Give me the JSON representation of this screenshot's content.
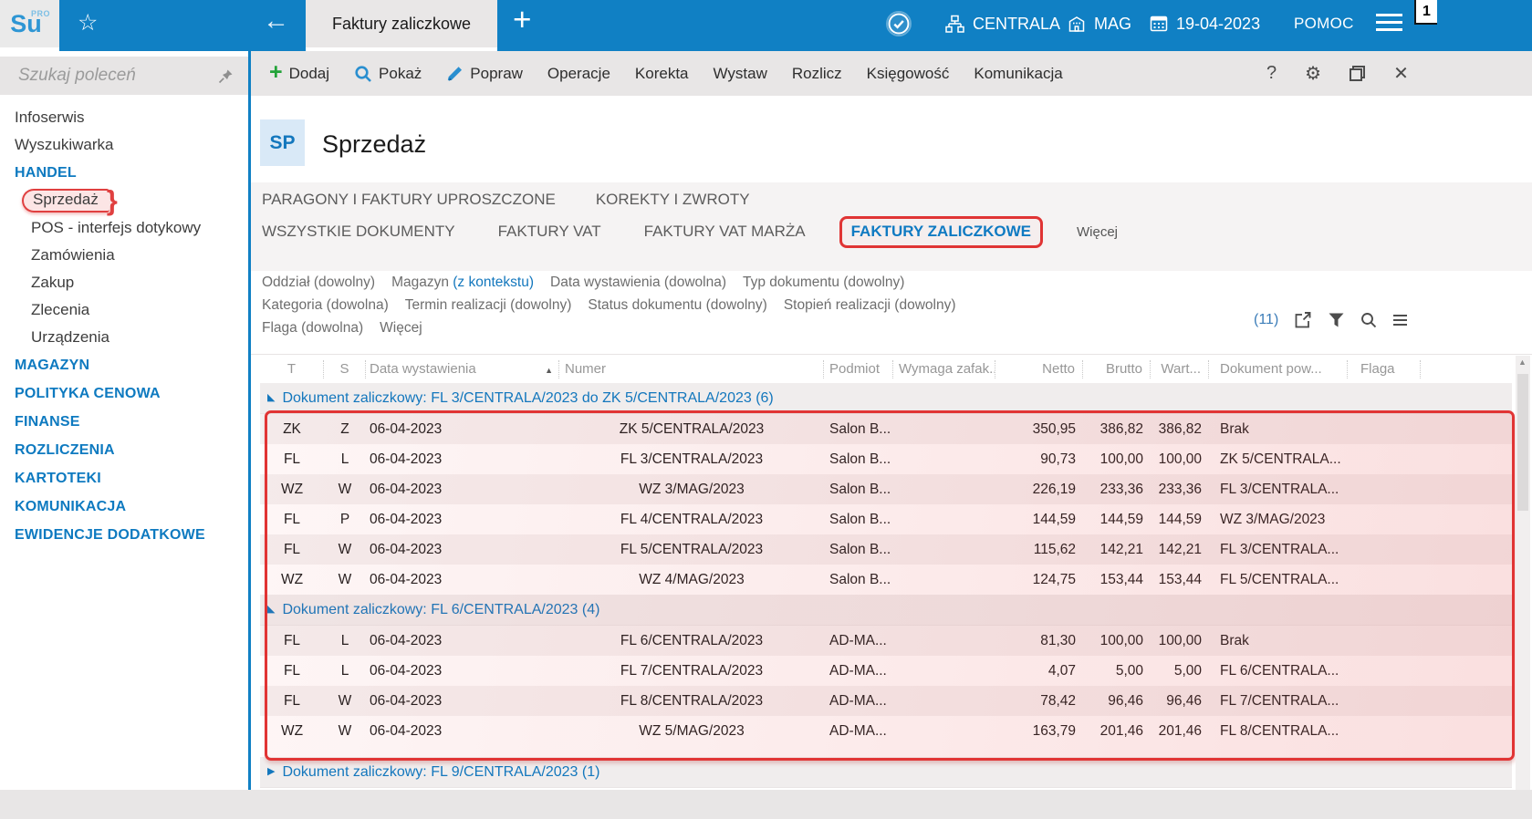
{
  "topbar": {
    "logo_text": "Su",
    "logo_sup": "PRO",
    "active_tab": "Faktury zaliczkowe",
    "branch": "CENTRALA",
    "warehouse": "MAG",
    "date": "19-04-2023",
    "help_label": "POMOC",
    "notification_count": "1"
  },
  "sidebar": {
    "search_placeholder": "Szukaj poleceń",
    "items": [
      {
        "label": "Infoserwis",
        "type": "item"
      },
      {
        "label": "Wyszukiwarka",
        "type": "item"
      },
      {
        "label": "HANDEL",
        "type": "section"
      },
      {
        "label": "Sprzedaż",
        "type": "subitem",
        "annotated": true
      },
      {
        "label": "POS - interfejs dotykowy",
        "type": "subitem"
      },
      {
        "label": "Zamówienia",
        "type": "subitem"
      },
      {
        "label": "Zakup",
        "type": "subitem"
      },
      {
        "label": "Zlecenia",
        "type": "subitem"
      },
      {
        "label": "Urządzenia",
        "type": "subitem"
      },
      {
        "label": "MAGAZYN",
        "type": "section"
      },
      {
        "label": "POLITYKA CENOWA",
        "type": "section"
      },
      {
        "label": "FINANSE",
        "type": "section"
      },
      {
        "label": "ROZLICZENIA",
        "type": "section"
      },
      {
        "label": "KARTOTEKI",
        "type": "section"
      },
      {
        "label": "KOMUNIKACJA",
        "type": "section"
      },
      {
        "label": "EWIDENCJE DODATKOWE",
        "type": "section"
      }
    ]
  },
  "toolbar": {
    "items": [
      {
        "label": "Dodaj",
        "icon": "plus-icon"
      },
      {
        "label": "Pokaż",
        "icon": "search-icon"
      },
      {
        "label": "Popraw",
        "icon": "brush-icon"
      },
      {
        "label": "Operacje"
      },
      {
        "label": "Korekta"
      },
      {
        "label": "Wystaw"
      },
      {
        "label": "Rozlicz"
      },
      {
        "label": "Księgowość"
      },
      {
        "label": "Komunikacja"
      }
    ]
  },
  "page": {
    "badge": "SP",
    "title": "Sprzedaż"
  },
  "tabs_row1": [
    {
      "label": "PARAGONY I FAKTURY UPROSZCZONE"
    },
    {
      "label": "KOREKTY I ZWROTY"
    }
  ],
  "tabs_row2": [
    {
      "label": "WSZYSTKIE DOKUMENTY"
    },
    {
      "label": "FAKTURY VAT"
    },
    {
      "label": "FAKTURY VAT MARŻA"
    },
    {
      "label": "FAKTURY ZALICZKOWE",
      "active": true,
      "annotated": true
    },
    {
      "label": "Więcej",
      "more": true
    }
  ],
  "filters": {
    "rows": [
      [
        {
          "name": "Oddział",
          "value": "(dowolny)"
        },
        {
          "name": "Magazyn",
          "value": "(z kontekstu)",
          "accent": true
        },
        {
          "name": "Data wystawienia",
          "value": "(dowolna)"
        },
        {
          "name": "Typ dokumentu",
          "value": "(dowolny)"
        }
      ],
      [
        {
          "name": "Kategoria",
          "value": "(dowolna)"
        },
        {
          "name": "Termin realizacji",
          "value": "(dowolny)"
        },
        {
          "name": "Status dokumentu",
          "value": "(dowolny)"
        },
        {
          "name": "Stopień realizacji",
          "value": "(dowolny)"
        }
      ],
      [
        {
          "name": "Flaga",
          "value": "(dowolna)"
        },
        {
          "name": "Więcej"
        }
      ]
    ],
    "record_count": "(11)"
  },
  "table": {
    "columns": [
      {
        "key": "t",
        "label": "T"
      },
      {
        "key": "s",
        "label": "S"
      },
      {
        "key": "data_wystawienia",
        "label": "Data wystawienia",
        "sorted": "asc"
      },
      {
        "key": "numer",
        "label": "Numer"
      },
      {
        "key": "podmiot",
        "label": "Podmiot"
      },
      {
        "key": "wymaga",
        "label": "Wymaga zafak..."
      },
      {
        "key": "netto",
        "label": "Netto"
      },
      {
        "key": "brutto",
        "label": "Brutto"
      },
      {
        "key": "wartosc",
        "label": "Wart..."
      },
      {
        "key": "dokument_pow",
        "label": "Dokument pow..."
      },
      {
        "key": "flaga",
        "label": "Flaga"
      }
    ],
    "groups": [
      {
        "label_prefix": "Dokument zaliczkowy:",
        "label_value": "FL 3/CENTRALA/2023 do ZK 5/CENTRALA/2023",
        "count": "(6)",
        "expanded": true,
        "rows": [
          {
            "t": "ZK",
            "s": "Z",
            "data_wystawienia": "06-04-2023",
            "numer": "ZK 5/CENTRALA/2023",
            "podmiot": "Salon B...",
            "wymaga": "",
            "netto": "350,95",
            "brutto": "386,82",
            "wartosc": "386,82",
            "dokument_pow": "Brak",
            "flaga": ""
          },
          {
            "t": "FL",
            "s": "L",
            "data_wystawienia": "06-04-2023",
            "numer": "FL 3/CENTRALA/2023",
            "podmiot": "Salon B...",
            "wymaga": "",
            "netto": "90,73",
            "brutto": "100,00",
            "wartosc": "100,00",
            "dokument_pow": "ZK 5/CENTRALA...",
            "flaga": ""
          },
          {
            "t": "WZ",
            "s": "W",
            "data_wystawienia": "06-04-2023",
            "numer": "WZ 3/MAG/2023",
            "podmiot": "Salon B...",
            "wymaga": "",
            "netto": "226,19",
            "brutto": "233,36",
            "wartosc": "233,36",
            "dokument_pow": "FL 3/CENTRALA...",
            "flaga": ""
          },
          {
            "t": "FL",
            "s": "P",
            "data_wystawienia": "06-04-2023",
            "numer": "FL 4/CENTRALA/2023",
            "podmiot": "Salon B...",
            "wymaga": "",
            "netto": "144,59",
            "brutto": "144,59",
            "wartosc": "144,59",
            "dokument_pow": "WZ 3/MAG/2023",
            "flaga": ""
          },
          {
            "t": "FL",
            "s": "W",
            "data_wystawienia": "06-04-2023",
            "numer": "FL 5/CENTRALA/2023",
            "podmiot": "Salon B...",
            "wymaga": "",
            "netto": "115,62",
            "brutto": "142,21",
            "wartosc": "142,21",
            "dokument_pow": "FL 3/CENTRALA...",
            "flaga": ""
          },
          {
            "t": "WZ",
            "s": "W",
            "data_wystawienia": "06-04-2023",
            "numer": "WZ 4/MAG/2023",
            "podmiot": "Salon B...",
            "wymaga": "",
            "netto": "124,75",
            "brutto": "153,44",
            "wartosc": "153,44",
            "dokument_pow": "FL 5/CENTRALA...",
            "flaga": ""
          }
        ]
      },
      {
        "label_prefix": "Dokument zaliczkowy:",
        "label_value": "FL 6/CENTRALA/2023",
        "count": "(4)",
        "expanded": true,
        "rows": [
          {
            "t": "FL",
            "s": "L",
            "data_wystawienia": "06-04-2023",
            "numer": "FL 6/CENTRALA/2023",
            "podmiot": "AD-MA...",
            "wymaga": "",
            "netto": "81,30",
            "brutto": "100,00",
            "wartosc": "100,00",
            "dokument_pow": "Brak",
            "flaga": ""
          },
          {
            "t": "FL",
            "s": "L",
            "data_wystawienia": "06-04-2023",
            "numer": "FL 7/CENTRALA/2023",
            "podmiot": "AD-MA...",
            "wymaga": "",
            "netto": "4,07",
            "brutto": "5,00",
            "wartosc": "5,00",
            "dokument_pow": "FL 6/CENTRALA...",
            "flaga": ""
          },
          {
            "t": "FL",
            "s": "W",
            "data_wystawienia": "06-04-2023",
            "numer": "FL 8/CENTRALA/2023",
            "podmiot": "AD-MA...",
            "wymaga": "",
            "netto": "78,42",
            "brutto": "96,46",
            "wartosc": "96,46",
            "dokument_pow": "FL 7/CENTRALA...",
            "flaga": ""
          },
          {
            "t": "WZ",
            "s": "W",
            "data_wystawienia": "06-04-2023",
            "numer": "WZ 5/MAG/2023",
            "podmiot": "AD-MA...",
            "wymaga": "",
            "netto": "163,79",
            "brutto": "201,46",
            "wartosc": "201,46",
            "dokument_pow": "FL 8/CENTRALA...",
            "flaga": ""
          }
        ]
      },
      {
        "label_prefix": "Dokument zaliczkowy:",
        "label_value": "FL 9/CENTRALA/2023",
        "count": "(1)",
        "expanded": false,
        "rows": []
      }
    ]
  },
  "colors": {
    "topbar_blue": "#1080c4",
    "accent_blue": "#1377bd",
    "annotation_red": "#e13434",
    "toolbar_gray": "#e8e6e6"
  }
}
